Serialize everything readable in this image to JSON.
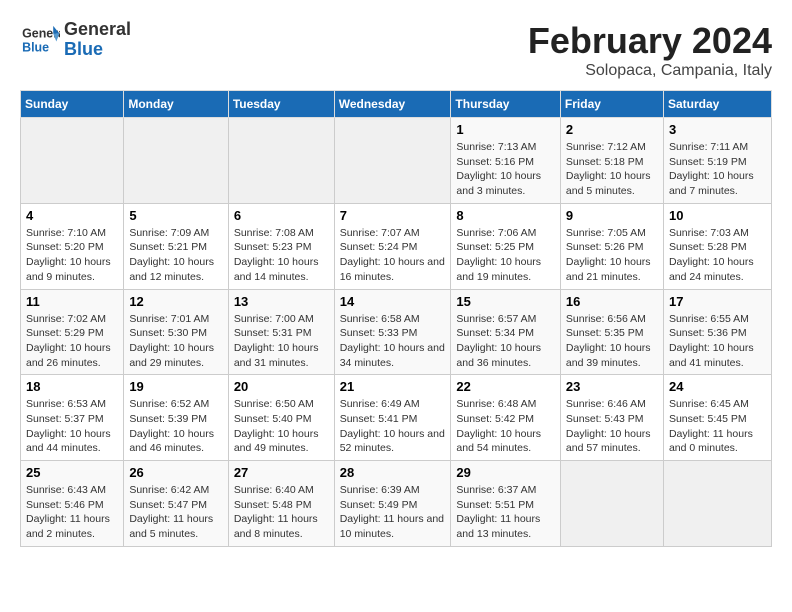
{
  "logo": {
    "text_general": "General",
    "text_blue": "Blue"
  },
  "title": "February 2024",
  "subtitle": "Solopaca, Campania, Italy",
  "days_of_week": [
    "Sunday",
    "Monday",
    "Tuesday",
    "Wednesday",
    "Thursday",
    "Friday",
    "Saturday"
  ],
  "weeks": [
    [
      {
        "day": "",
        "info": ""
      },
      {
        "day": "",
        "info": ""
      },
      {
        "day": "",
        "info": ""
      },
      {
        "day": "",
        "info": ""
      },
      {
        "day": "1",
        "info": "Sunrise: 7:13 AM\nSunset: 5:16 PM\nDaylight: 10 hours and 3 minutes."
      },
      {
        "day": "2",
        "info": "Sunrise: 7:12 AM\nSunset: 5:18 PM\nDaylight: 10 hours and 5 minutes."
      },
      {
        "day": "3",
        "info": "Sunrise: 7:11 AM\nSunset: 5:19 PM\nDaylight: 10 hours and 7 minutes."
      }
    ],
    [
      {
        "day": "4",
        "info": "Sunrise: 7:10 AM\nSunset: 5:20 PM\nDaylight: 10 hours and 9 minutes."
      },
      {
        "day": "5",
        "info": "Sunrise: 7:09 AM\nSunset: 5:21 PM\nDaylight: 10 hours and 12 minutes."
      },
      {
        "day": "6",
        "info": "Sunrise: 7:08 AM\nSunset: 5:23 PM\nDaylight: 10 hours and 14 minutes."
      },
      {
        "day": "7",
        "info": "Sunrise: 7:07 AM\nSunset: 5:24 PM\nDaylight: 10 hours and 16 minutes."
      },
      {
        "day": "8",
        "info": "Sunrise: 7:06 AM\nSunset: 5:25 PM\nDaylight: 10 hours and 19 minutes."
      },
      {
        "day": "9",
        "info": "Sunrise: 7:05 AM\nSunset: 5:26 PM\nDaylight: 10 hours and 21 minutes."
      },
      {
        "day": "10",
        "info": "Sunrise: 7:03 AM\nSunset: 5:28 PM\nDaylight: 10 hours and 24 minutes."
      }
    ],
    [
      {
        "day": "11",
        "info": "Sunrise: 7:02 AM\nSunset: 5:29 PM\nDaylight: 10 hours and 26 minutes."
      },
      {
        "day": "12",
        "info": "Sunrise: 7:01 AM\nSunset: 5:30 PM\nDaylight: 10 hours and 29 minutes."
      },
      {
        "day": "13",
        "info": "Sunrise: 7:00 AM\nSunset: 5:31 PM\nDaylight: 10 hours and 31 minutes."
      },
      {
        "day": "14",
        "info": "Sunrise: 6:58 AM\nSunset: 5:33 PM\nDaylight: 10 hours and 34 minutes."
      },
      {
        "day": "15",
        "info": "Sunrise: 6:57 AM\nSunset: 5:34 PM\nDaylight: 10 hours and 36 minutes."
      },
      {
        "day": "16",
        "info": "Sunrise: 6:56 AM\nSunset: 5:35 PM\nDaylight: 10 hours and 39 minutes."
      },
      {
        "day": "17",
        "info": "Sunrise: 6:55 AM\nSunset: 5:36 PM\nDaylight: 10 hours and 41 minutes."
      }
    ],
    [
      {
        "day": "18",
        "info": "Sunrise: 6:53 AM\nSunset: 5:37 PM\nDaylight: 10 hours and 44 minutes."
      },
      {
        "day": "19",
        "info": "Sunrise: 6:52 AM\nSunset: 5:39 PM\nDaylight: 10 hours and 46 minutes."
      },
      {
        "day": "20",
        "info": "Sunrise: 6:50 AM\nSunset: 5:40 PM\nDaylight: 10 hours and 49 minutes."
      },
      {
        "day": "21",
        "info": "Sunrise: 6:49 AM\nSunset: 5:41 PM\nDaylight: 10 hours and 52 minutes."
      },
      {
        "day": "22",
        "info": "Sunrise: 6:48 AM\nSunset: 5:42 PM\nDaylight: 10 hours and 54 minutes."
      },
      {
        "day": "23",
        "info": "Sunrise: 6:46 AM\nSunset: 5:43 PM\nDaylight: 10 hours and 57 minutes."
      },
      {
        "day": "24",
        "info": "Sunrise: 6:45 AM\nSunset: 5:45 PM\nDaylight: 11 hours and 0 minutes."
      }
    ],
    [
      {
        "day": "25",
        "info": "Sunrise: 6:43 AM\nSunset: 5:46 PM\nDaylight: 11 hours and 2 minutes."
      },
      {
        "day": "26",
        "info": "Sunrise: 6:42 AM\nSunset: 5:47 PM\nDaylight: 11 hours and 5 minutes."
      },
      {
        "day": "27",
        "info": "Sunrise: 6:40 AM\nSunset: 5:48 PM\nDaylight: 11 hours and 8 minutes."
      },
      {
        "day": "28",
        "info": "Sunrise: 6:39 AM\nSunset: 5:49 PM\nDaylight: 11 hours and 10 minutes."
      },
      {
        "day": "29",
        "info": "Sunrise: 6:37 AM\nSunset: 5:51 PM\nDaylight: 11 hours and 13 minutes."
      },
      {
        "day": "",
        "info": ""
      },
      {
        "day": "",
        "info": ""
      }
    ]
  ]
}
